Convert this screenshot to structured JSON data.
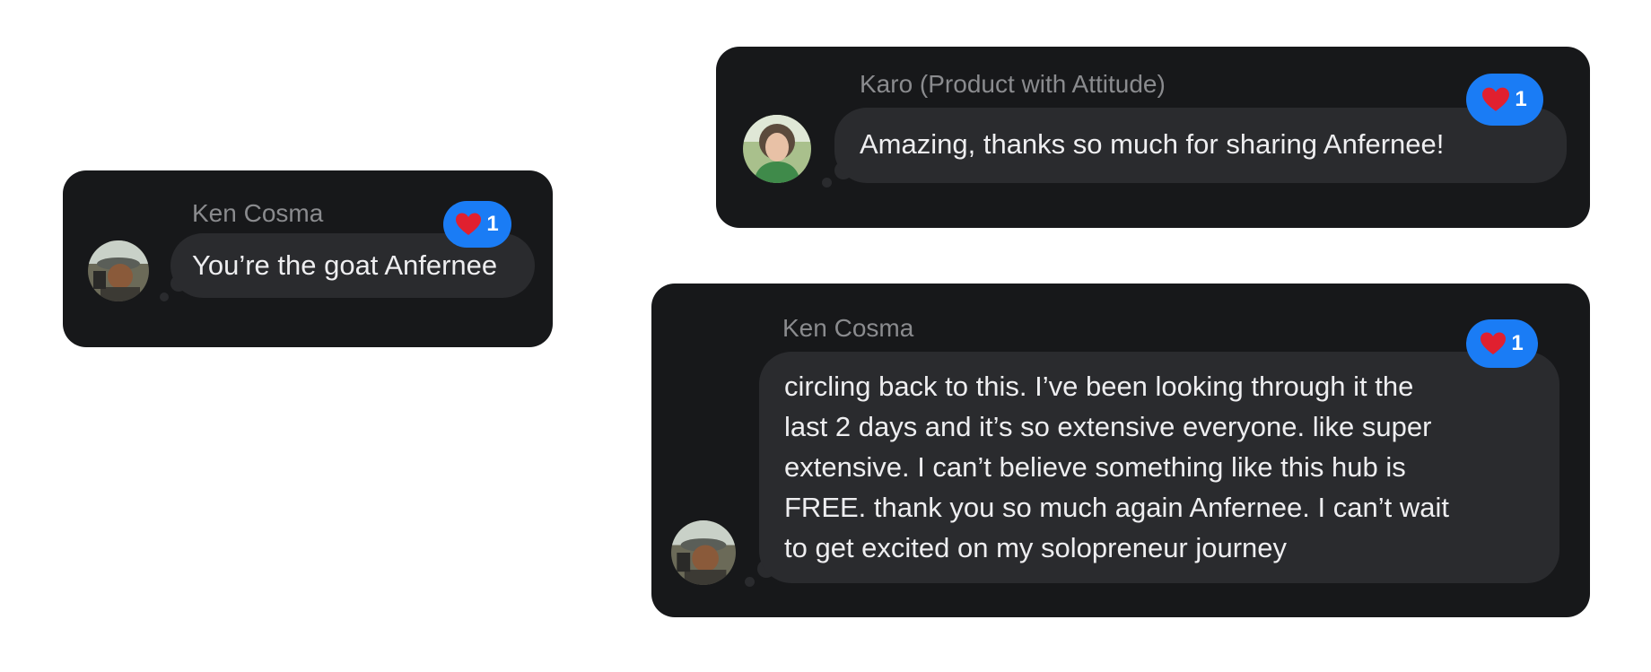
{
  "messages": [
    {
      "sender": "Ken Cosma",
      "text": "You’re the goat Anfernee",
      "reaction": {
        "icon": "heart-icon",
        "count": "1"
      }
    },
    {
      "sender": "Karo (Product with Attitude)",
      "text": "Amazing, thanks so much for sharing Anfernee!",
      "reaction": {
        "icon": "heart-icon",
        "count": "1"
      }
    },
    {
      "sender": "Ken Cosma",
      "text": "circling back to this. I’ve been looking through it the\nlast 2 days and it’s so extensive everyone. like super\nextensive. I can’t believe something like this hub is\nFREE. thank you so much again Anfernee. I can’t wait\nto get excited on my solopreneur journey",
      "reaction": {
        "icon": "heart-icon",
        "count": "1"
      }
    }
  ],
  "colors": {
    "card_bg": "#17181a",
    "bubble_bg": "#2a2b2e",
    "sender_text": "#8a8b8e",
    "message_text": "#eeeef0",
    "reaction_bg": "#1a7cf5",
    "heart": "#e0202f"
  }
}
